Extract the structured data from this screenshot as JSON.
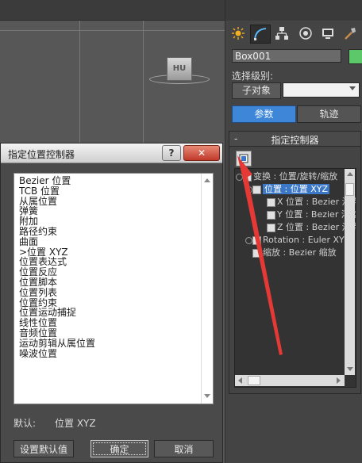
{
  "viewport": {
    "viewcube_label": "HU"
  },
  "command_panel": {
    "tabs": [
      {
        "name": "create-icon"
      },
      {
        "name": "modify-icon"
      },
      {
        "name": "hierarchy-icon"
      },
      {
        "name": "motion-icon"
      },
      {
        "name": "display-icon"
      },
      {
        "name": "utilities-icon"
      }
    ],
    "object_name": "Box001",
    "object_color": "#5cc86a",
    "selection_level_label": "选择级别:",
    "subobject_label": "子对象",
    "subobject_dropdown_value": "",
    "params_label": "参数",
    "trajectory_label": "轨迹",
    "rollout": {
      "collapse_symbol": "-",
      "title": "指定控制器",
      "tree": [
        {
          "text": "变换 : 位置/旋转/缩放"
        },
        {
          "text": "位置 : 位置 XYZ"
        },
        {
          "text": "X 位置 : Bezier 浮点"
        },
        {
          "text": "Y 位置 : Bezier 浮点"
        },
        {
          "text": "Z 位置 : Bezier 浮点"
        },
        {
          "text": "Rotation : Euler XYZ"
        },
        {
          "text": "缩放 : Bezier 缩放"
        }
      ]
    }
  },
  "dialog": {
    "title": "指定位置控制器",
    "help_label": "?",
    "close_label": "✕",
    "list_items": [
      "Bezier 位置",
      "TCB 位置",
      "从属位置",
      "弹簧",
      "附加",
      "路径约束",
      "曲面",
      ">位置 XYZ",
      "位置表达式",
      "位置反应",
      "位置脚本",
      "位置列表",
      "位置约束",
      "位置运动捕捉",
      "线性位置",
      "音频位置",
      "运动剪辑从属位置",
      "噪波位置"
    ],
    "default_label": "默认:",
    "default_value": "位置 XYZ",
    "set_default_label": "设置默认值",
    "ok_label": "确定",
    "cancel_label": "取消"
  },
  "annotation": {
    "arrow_color": "#e53935"
  }
}
